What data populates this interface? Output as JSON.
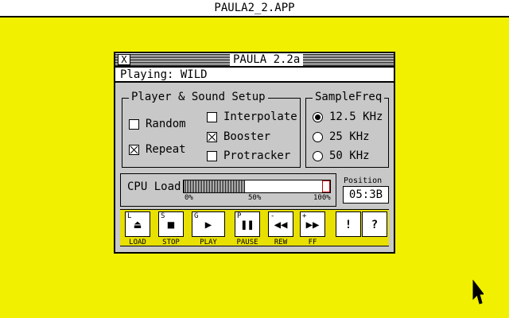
{
  "desktop": {
    "app_title": "PAULA2_2.APP"
  },
  "window": {
    "title": "PAULA 2.2a",
    "close_glyph": "X",
    "playing_label": "Playing:",
    "playing_track": "WILD"
  },
  "setup": {
    "title": "Player & Sound Setup",
    "options": [
      {
        "label": "Random",
        "checked": false
      },
      {
        "label": "Repeat",
        "checked": true
      },
      {
        "label": "Interpolate",
        "checked": false
      },
      {
        "label": "Booster",
        "checked": true
      },
      {
        "label": "Protracker",
        "checked": false
      }
    ]
  },
  "samplefreq": {
    "title": "SampleFreq",
    "options": [
      {
        "label": "12.5 KHz",
        "selected": true
      },
      {
        "label": "25 KHz",
        "selected": false
      },
      {
        "label": "50 KHz",
        "selected": false
      }
    ]
  },
  "cpu": {
    "label": "CPU Load",
    "load_fraction": 0.42,
    "scale": [
      "0%",
      "50%",
      "100%"
    ]
  },
  "position": {
    "label": "Position",
    "value": "05:3B"
  },
  "transport": {
    "buttons": [
      {
        "key": "L",
        "glyph": "⏏",
        "label": "LOAD",
        "icon": "eject-icon"
      },
      {
        "key": "S",
        "glyph": "■",
        "label": "STOP",
        "icon": "stop-icon"
      },
      {
        "key": "G",
        "glyph": "▶",
        "label": "PLAY",
        "icon": "play-icon"
      },
      {
        "key": "P",
        "glyph": "❚❚",
        "label": "PAUSE",
        "icon": "pause-icon"
      },
      {
        "key": "-",
        "glyph": "◀◀",
        "label": "REW",
        "icon": "rewind-icon"
      },
      {
        "key": "+",
        "glyph": "▶▶",
        "label": "FF",
        "icon": "fast-forward-icon"
      }
    ],
    "info_glyph": "!",
    "help_glyph": "?"
  },
  "colors": {
    "desktop": "#f0f000",
    "window": "#c8c8c8",
    "button_strip": "#e8e000"
  }
}
